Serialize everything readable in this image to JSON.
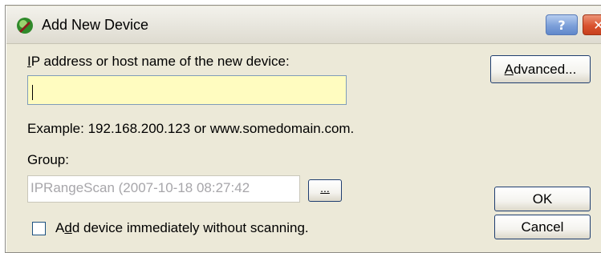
{
  "window": {
    "title": "Add New Device",
    "app_icon": "device-globe-icon",
    "help_glyph": "?",
    "close_glyph": "✕"
  },
  "form": {
    "ip_label_mnemonic": "I",
    "ip_label_rest": "P address or host name of the new device:",
    "ip_value": "",
    "example_text": "Example: 192.168.200.123 or www.somedomain.com.",
    "group_label": "Group:",
    "group_value": "IPRangeScan (2007-10-18 08:27:42",
    "browse_label": "...",
    "checkbox_label_pre": "A",
    "checkbox_label_mnemonic": "d",
    "checkbox_label_rest": "d device immediately without scanning.",
    "checkbox_checked": false
  },
  "buttons": {
    "advanced_mnemonic": "A",
    "advanced_rest": "dvanced...",
    "ok": "OK",
    "cancel": "Cancel"
  },
  "colors": {
    "dialog_bg": "#ece9d8",
    "input_highlight": "#fffcc0",
    "disabled_text": "#a7a6aa"
  }
}
